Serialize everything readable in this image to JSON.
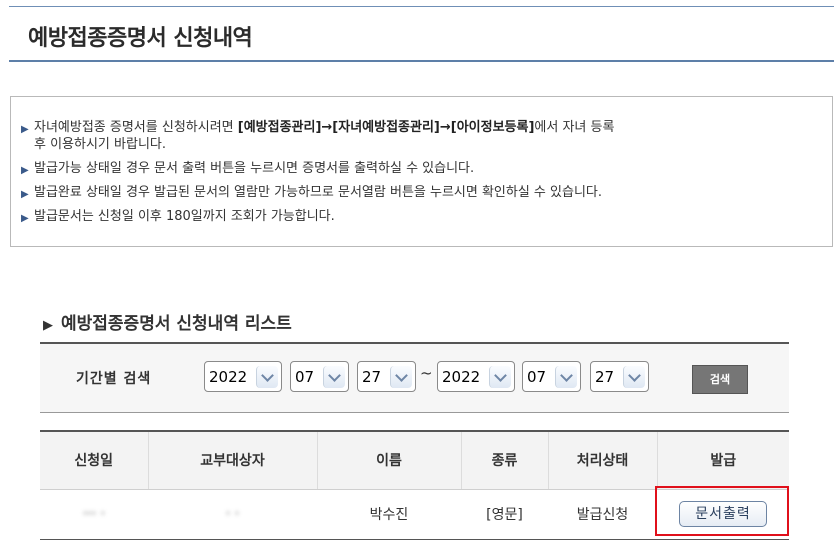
{
  "page": {
    "title": "예방접종증명서 신청내역"
  },
  "info": {
    "items": [
      {
        "before": "자녀예방접종 증명서를 신청하시려면 ",
        "bold": "[예방접종관리]→[자녀예방접종관리]→[아이정보등록]",
        "after": "에서 자녀 등록",
        "cont": "후 이용하시기 바랍니다."
      },
      {
        "text": "발급가능 상태일 경우 문서 출력 버튼을 누르시면 증명서를 출력하실 수 있습니다."
      },
      {
        "text": "발급완료 상태일 경우 발급된 문서의 열람만 가능하므로 문서열람 버튼을 누르시면 확인하실 수 있습니다."
      },
      {
        "text": "발급문서는 신청일 이후 180일까지 조회가 가능합니다."
      }
    ]
  },
  "list": {
    "title": "예방접종증명서 신청내역 리스트"
  },
  "search": {
    "label": "기간별 검색",
    "from": {
      "year": "2022",
      "month": "07",
      "day": "27"
    },
    "tilde": "~",
    "to": {
      "year": "2022",
      "month": "07",
      "day": "27"
    },
    "button": "검색"
  },
  "table": {
    "headers": [
      "신청일",
      "교부대상자",
      "이름",
      "종류",
      "처리상태",
      "발급"
    ],
    "rows": [
      {
        "date": "··· ·",
        "target": "· ·",
        "name": "박수진",
        "type": "[영문]",
        "status": "발급신청",
        "action": "문서출력"
      }
    ]
  },
  "colors": {
    "accent_line": "#5d7fa8",
    "highlight": "#e0101b",
    "search_button": "#767676"
  }
}
